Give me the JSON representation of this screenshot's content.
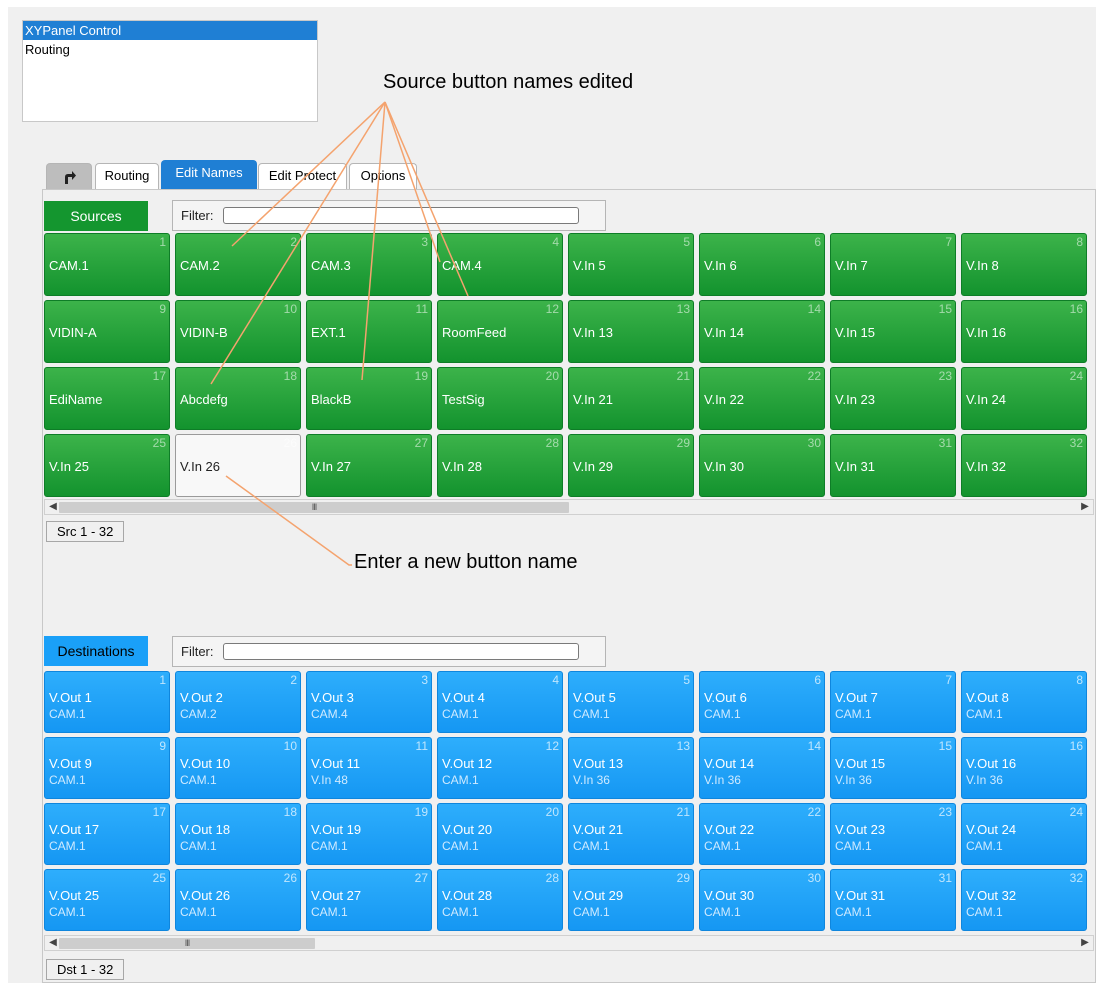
{
  "tree": {
    "items": [
      "XYPanel Control",
      "Routing"
    ]
  },
  "tabs": {
    "back_icon": "return-arrow-icon",
    "routing": "Routing",
    "edit_names": "Edit Names",
    "edit_protect": "Edit Protect",
    "options": "Options"
  },
  "sources": {
    "label": "Sources",
    "filter_label": "Filter:",
    "filter_value": "",
    "buttons": [
      {
        "n": "1",
        "name": "CAM.1"
      },
      {
        "n": "2",
        "name": "CAM.2"
      },
      {
        "n": "3",
        "name": "CAM.3"
      },
      {
        "n": "4",
        "name": "CAM.4"
      },
      {
        "n": "5",
        "name": "V.In 5"
      },
      {
        "n": "6",
        "name": "V.In 6"
      },
      {
        "n": "7",
        "name": "V.In 7"
      },
      {
        "n": "8",
        "name": "V.In 8"
      },
      {
        "n": "9",
        "name": "VIDIN-A"
      },
      {
        "n": "10",
        "name": "VIDIN-B"
      },
      {
        "n": "11",
        "name": "EXT.1"
      },
      {
        "n": "12",
        "name": "RoomFeed"
      },
      {
        "n": "13",
        "name": "V.In 13"
      },
      {
        "n": "14",
        "name": "V.In 14"
      },
      {
        "n": "15",
        "name": "V.In 15"
      },
      {
        "n": "16",
        "name": "V.In 16"
      },
      {
        "n": "17",
        "name": "EdiName"
      },
      {
        "n": "18",
        "name": "Abcdefg"
      },
      {
        "n": "19",
        "name": "BlackB"
      },
      {
        "n": "20",
        "name": "TestSig"
      },
      {
        "n": "21",
        "name": "V.In 21"
      },
      {
        "n": "22",
        "name": "V.In 22"
      },
      {
        "n": "23",
        "name": "V.In 23"
      },
      {
        "n": "24",
        "name": "V.In 24"
      },
      {
        "n": "25",
        "name": "V.In 25"
      },
      {
        "n": "26",
        "name": "V.In 26"
      },
      {
        "n": "27",
        "name": "V.In 27"
      },
      {
        "n": "28",
        "name": "V.In 28"
      },
      {
        "n": "29",
        "name": "V.In 29"
      },
      {
        "n": "30",
        "name": "V.In 30"
      },
      {
        "n": "31",
        "name": "V.In 31"
      },
      {
        "n": "32",
        "name": "V.In 32"
      }
    ],
    "editing_index": 25,
    "scroll_thumb": "III",
    "page_label": "Src 1 - 32"
  },
  "destinations": {
    "label": "Destinations",
    "filter_label": "Filter:",
    "filter_value": "",
    "buttons": [
      {
        "n": "1",
        "name": "V.Out 1",
        "src": "CAM.1"
      },
      {
        "n": "2",
        "name": "V.Out 2",
        "src": "CAM.2"
      },
      {
        "n": "3",
        "name": "V.Out 3",
        "src": "CAM.4"
      },
      {
        "n": "4",
        "name": "V.Out 4",
        "src": "CAM.1"
      },
      {
        "n": "5",
        "name": "V.Out 5",
        "src": "CAM.1"
      },
      {
        "n": "6",
        "name": "V.Out 6",
        "src": "CAM.1"
      },
      {
        "n": "7",
        "name": "V.Out 7",
        "src": "CAM.1"
      },
      {
        "n": "8",
        "name": "V.Out 8",
        "src": "CAM.1"
      },
      {
        "n": "9",
        "name": "V.Out 9",
        "src": "CAM.1"
      },
      {
        "n": "10",
        "name": "V.Out 10",
        "src": "CAM.1"
      },
      {
        "n": "11",
        "name": "V.Out 11",
        "src": "V.In 48"
      },
      {
        "n": "12",
        "name": "V.Out 12",
        "src": "CAM.1"
      },
      {
        "n": "13",
        "name": "V.Out 13",
        "src": "V.In 36"
      },
      {
        "n": "14",
        "name": "V.Out 14",
        "src": "V.In 36"
      },
      {
        "n": "15",
        "name": "V.Out 15",
        "src": "V.In 36"
      },
      {
        "n": "16",
        "name": "V.Out 16",
        "src": "V.In 36"
      },
      {
        "n": "17",
        "name": "V.Out 17",
        "src": "CAM.1"
      },
      {
        "n": "18",
        "name": "V.Out 18",
        "src": "CAM.1"
      },
      {
        "n": "19",
        "name": "V.Out 19",
        "src": "CAM.1"
      },
      {
        "n": "20",
        "name": "V.Out 20",
        "src": "CAM.1"
      },
      {
        "n": "21",
        "name": "V.Out 21",
        "src": "CAM.1"
      },
      {
        "n": "22",
        "name": "V.Out 22",
        "src": "CAM.1"
      },
      {
        "n": "23",
        "name": "V.Out 23",
        "src": "CAM.1"
      },
      {
        "n": "24",
        "name": "V.Out 24",
        "src": "CAM.1"
      },
      {
        "n": "25",
        "name": "V.Out 25",
        "src": "CAM.1"
      },
      {
        "n": "26",
        "name": "V.Out 26",
        "src": "CAM.1"
      },
      {
        "n": "27",
        "name": "V.Out 27",
        "src": "CAM.1"
      },
      {
        "n": "28",
        "name": "V.Out 28",
        "src": "CAM.1"
      },
      {
        "n": "29",
        "name": "V.Out 29",
        "src": "CAM.1"
      },
      {
        "n": "30",
        "name": "V.Out 30",
        "src": "CAM.1"
      },
      {
        "n": "31",
        "name": "V.Out 31",
        "src": "CAM.1"
      },
      {
        "n": "32",
        "name": "V.Out 32",
        "src": "CAM.1"
      }
    ],
    "scroll_thumb": "III",
    "page_label": "Dst 1 - 32"
  },
  "callouts": {
    "edited": "Source button names edited",
    "enter_new": "Enter a new button name"
  },
  "colors": {
    "selection_blue": "#1f7fd4",
    "source_green": "#13932e",
    "destination_blue": "#1597f3",
    "callout_line": "#f4a36e"
  }
}
